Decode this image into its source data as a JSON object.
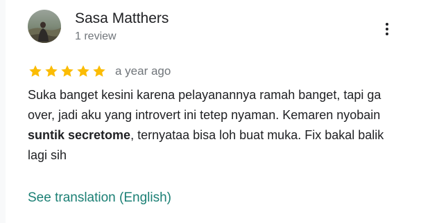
{
  "review": {
    "reviewer_name": "Sasa Matthers",
    "review_count": "1 review",
    "rating": 5,
    "rating_max": 5,
    "date": "a year ago",
    "text_part1": "Suka banget kesini karena pelayanannya ramah banget, tapi ga over, jadi aku yang introvert ini tetep nyaman. Kemaren nyobain ",
    "text_bold": "suntik secretome",
    "text_part2": ", ternyataa bisa loh buat muka. Fix bakal balik lagi sih",
    "translation_link": "See translation (English)"
  },
  "icons": {
    "more": "more-vert-icon",
    "star": "star-icon"
  },
  "colors": {
    "star": "#fbbc04",
    "link": "#1a7f74",
    "primary_text": "#202124",
    "secondary_text": "#70757a"
  }
}
